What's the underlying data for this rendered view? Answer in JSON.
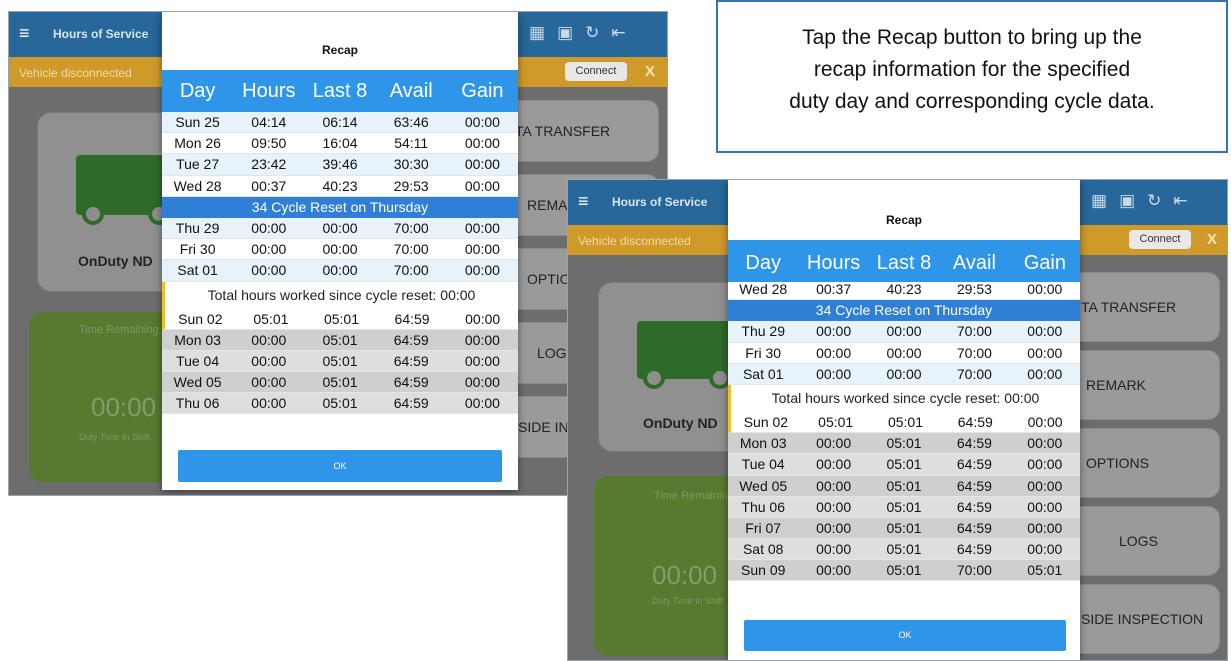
{
  "callout": {
    "line1": "Tap the Recap button to bring up the",
    "line2": "recap information for the specified",
    "line3": "duty day and corresponding cycle data."
  },
  "app": {
    "title": "Hours of Service",
    "warning": "Vehicle disconnected",
    "connect_label": "Connect",
    "close_label": "X",
    "status_label": "OnDuty ND",
    "time_remaining_label": "Time Remaining",
    "time_value": "00:00",
    "duty_time_label": "Duty Time In Shift",
    "icons": [
      "menu-icon",
      "message-icon",
      "shipping-icon",
      "refresh-icon",
      "logout-icon"
    ]
  },
  "left_screen": {
    "side_buttons": [
      "TA TRANSFER",
      "REMARK",
      "OPTIONS",
      "LOGS",
      "SIDE INSPECTION"
    ]
  },
  "right_screen": {
    "side_buttons": [
      "TA TRANSFER",
      "REMARK",
      "OPTIONS",
      "LOGS",
      "SIDE INSPECTION"
    ]
  },
  "recap": {
    "title": "Recap",
    "ok_label": "OK",
    "columns": [
      "Day",
      "Hours",
      "Last 8",
      "Avail",
      "Gain"
    ],
    "reset_banner": "34 Cycle Reset on Thursday",
    "total_note": "Total hours worked since cycle reset: 00:00",
    "pre_reset_rows": [
      [
        "Sun 25",
        "04:14",
        "06:14",
        "63:46",
        "00:00"
      ],
      [
        "Mon 26",
        "09:50",
        "16:04",
        "54:11",
        "00:00"
      ],
      [
        "Tue 27",
        "23:42",
        "39:46",
        "30:30",
        "00:00"
      ],
      [
        "Wed 28",
        "00:37",
        "40:23",
        "29:53",
        "00:00"
      ]
    ],
    "reset_rows": [
      [
        "Thu 29",
        "00:00",
        "00:00",
        "70:00",
        "00:00"
      ],
      [
        "Fri 30",
        "00:00",
        "00:00",
        "70:00",
        "00:00"
      ],
      [
        "Sat 01",
        "00:00",
        "00:00",
        "70:00",
        "00:00"
      ]
    ],
    "left_after_rows": [
      [
        "Sun 02",
        "05:01",
        "05:01",
        "64:59",
        "00:00"
      ],
      [
        "Mon 03",
        "00:00",
        "05:01",
        "64:59",
        "00:00"
      ],
      [
        "Tue 04",
        "00:00",
        "05:01",
        "64:59",
        "00:00"
      ],
      [
        "Wed 05",
        "00:00",
        "05:01",
        "64:59",
        "00:00"
      ],
      [
        "Thu 06",
        "00:00",
        "05:01",
        "64:59",
        "00:00"
      ]
    ],
    "right_after_rows": [
      [
        "Sun 02",
        "05:01",
        "05:01",
        "64:59",
        "00:00"
      ],
      [
        "Mon 03",
        "00:00",
        "05:01",
        "64:59",
        "00:00"
      ],
      [
        "Tue 04",
        "00:00",
        "05:01",
        "64:59",
        "00:00"
      ],
      [
        "Wed 05",
        "00:00",
        "05:01",
        "64:59",
        "00:00"
      ],
      [
        "Thu 06",
        "00:00",
        "05:01",
        "64:59",
        "00:00"
      ],
      [
        "Fri 07",
        "00:00",
        "05:01",
        "64:59",
        "00:00"
      ],
      [
        "Sat 08",
        "00:00",
        "05:01",
        "64:59",
        "00:00"
      ],
      [
        "Sun 09",
        "00:00",
        "05:01",
        "70:00",
        "05:01"
      ]
    ]
  }
}
